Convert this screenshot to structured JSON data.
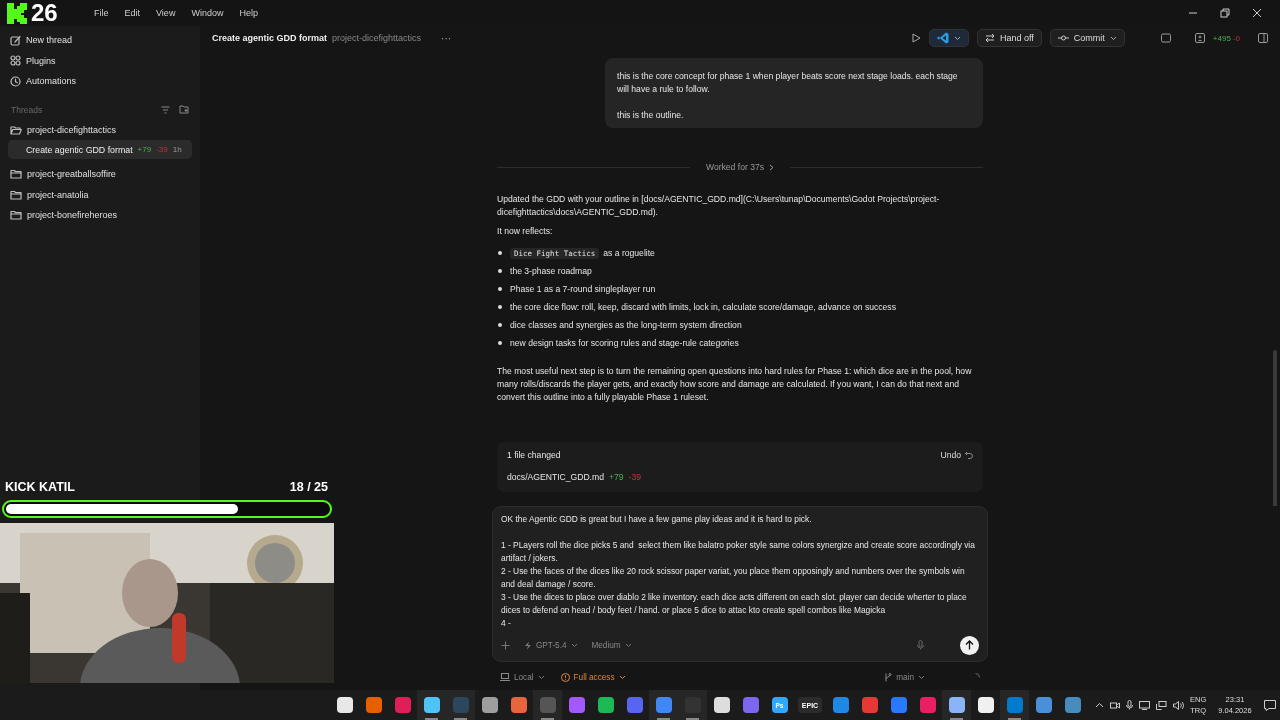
{
  "overlay_logo": {
    "text": "26"
  },
  "menu": [
    "File",
    "Edit",
    "View",
    "Window",
    "Help"
  ],
  "sidebar": {
    "top_items": [
      {
        "label": "New thread",
        "kind": "edit"
      },
      {
        "label": "Plugins",
        "kind": "grid"
      },
      {
        "label": "Automations",
        "kind": "clock"
      }
    ],
    "threads_heading": "Threads",
    "projects": [
      {
        "name": "project-dicefighttactics",
        "expanded": true,
        "threads": [
          {
            "title": "Create agentic GDD format",
            "added": "+79",
            "removed": "-39",
            "age": "1h",
            "selected": true
          }
        ]
      },
      {
        "name": "project-greatballsoffire",
        "expanded": false
      },
      {
        "name": "project-anatolia",
        "expanded": false
      },
      {
        "name": "project-bonefireheroes",
        "expanded": false
      }
    ]
  },
  "header": {
    "title": "Create agentic GDD format",
    "project": "project-dicefighttactics",
    "more": "···",
    "handoff": "Hand off",
    "commit": "Commit",
    "added": "+495",
    "removed": "-0"
  },
  "chat": {
    "user_message": [
      "this is the core concept for phase 1 when player beats score next stage loads. each stage will have a rule to follow.",
      "this is the outline."
    ],
    "worked": "Worked for 37s",
    "response": [
      {
        "kind": "paragraph",
        "text": "Updated the GDD with your outline in [docs/AGENTIC_GDD.md](C:\\Users\\tunap\\Documents\\Godot Projects\\project-dicefighttactics\\docs\\AGENTIC_GDD.md)."
      },
      {
        "kind": "paragraph",
        "text": "It now reflects:"
      },
      {
        "kind": "list",
        "items": [
          {
            "code": "Dice Fight Tactics",
            "text": "as a roguelite"
          },
          {
            "text": "the 3-phase roadmap"
          },
          {
            "text": "Phase 1 as a 7-round singleplayer run"
          },
          {
            "text": "the core dice flow: roll, keep, discard with limits, lock in, calculate score/damage, advance on success"
          },
          {
            "text": "dice classes and synergies as the long-term system direction"
          },
          {
            "text": "new design tasks for scoring rules and stage-rule categories"
          }
        ]
      },
      {
        "kind": "paragraph",
        "text": "The most useful next step is to turn the remaining open questions into hard rules for Phase 1: which dice are in the pool, how many rolls/discards the player gets, and exactly how score and damage are calculated. If you want, I can do that next and convert this outline into a fully playable Phase 1 ruleset."
      }
    ],
    "changes": {
      "title": "1 file changed",
      "undo": "Undo",
      "files": [
        {
          "path": "docs/AGENTIC_GDD.md",
          "added": "+79",
          "removed": "-39"
        }
      ]
    }
  },
  "composer": {
    "value": "OK the Agentic GDD is great but I have a few game play ideas and it is hard to pick.\n\n1 - PLayers roll the dice picks 5 and  select them like balatro poker style same colors synergize and create score accordingly via artifact / jokers.\n2 - Use the faces of the dices like 20 rock scissor paper variat, you place them opposingly and numbers over the symbols win and deal damage / score.\n3 - Use the dices to place over diablo 2 like inventory. each dice acts different on each slot. player can decide wherter to place dices to defend on head / body feet / hand. or place 5 dice to attac kto create spell combos like Magicka\n4 -",
    "model": "GPT-5.4",
    "effort": "Medium"
  },
  "footer": {
    "location": "Local",
    "access": "Full access",
    "branch": "main"
  },
  "stream": {
    "title": "KICK KATIL",
    "count": "18 / 25",
    "level": 0.72
  },
  "taskbar": {
    "apps": [
      {
        "color": "#e8e8e8",
        "running": false
      },
      {
        "color": "#e66000",
        "running": false
      },
      {
        "color": "#e01e5a",
        "running": false
      },
      {
        "color": "#4fc3f7",
        "running": true
      },
      {
        "color": "#2a475e",
        "running": true
      },
      {
        "color": "#9e9e9e",
        "running": false
      },
      {
        "color": "#e8643c",
        "running": false
      },
      {
        "color": "#555555",
        "running": true
      },
      {
        "color": "#a259ff",
        "running": false
      },
      {
        "color": "#1db954",
        "running": false
      },
      {
        "color": "#5865f2",
        "running": false
      },
      {
        "color": "#4285f4",
        "running": true
      },
      {
        "color": "#333333",
        "running": true
      },
      {
        "color": "#dddddd",
        "running": false
      },
      {
        "color": "#7b68ee",
        "running": false
      },
      {
        "color": "#31a8ff",
        "running": false,
        "label": "Ps"
      },
      {
        "color": "#2b2b2b",
        "running": false,
        "label": "EPIC"
      },
      {
        "color": "#1e88e5",
        "running": false
      },
      {
        "color": "#e53935",
        "running": false
      },
      {
        "color": "#2979ff",
        "running": false
      },
      {
        "color": "#e91e63",
        "running": false
      },
      {
        "color": "#8ab4f8",
        "running": true
      },
      {
        "color": "#f0f0f0",
        "running": false
      },
      {
        "color": "#007acc",
        "running": true
      },
      {
        "color": "#4a90d9",
        "running": false
      },
      {
        "color": "#478cbf",
        "running": false
      }
    ],
    "lang": "ENG",
    "layout": "TRQ",
    "time": "23:31",
    "date": "9.04.2026"
  }
}
